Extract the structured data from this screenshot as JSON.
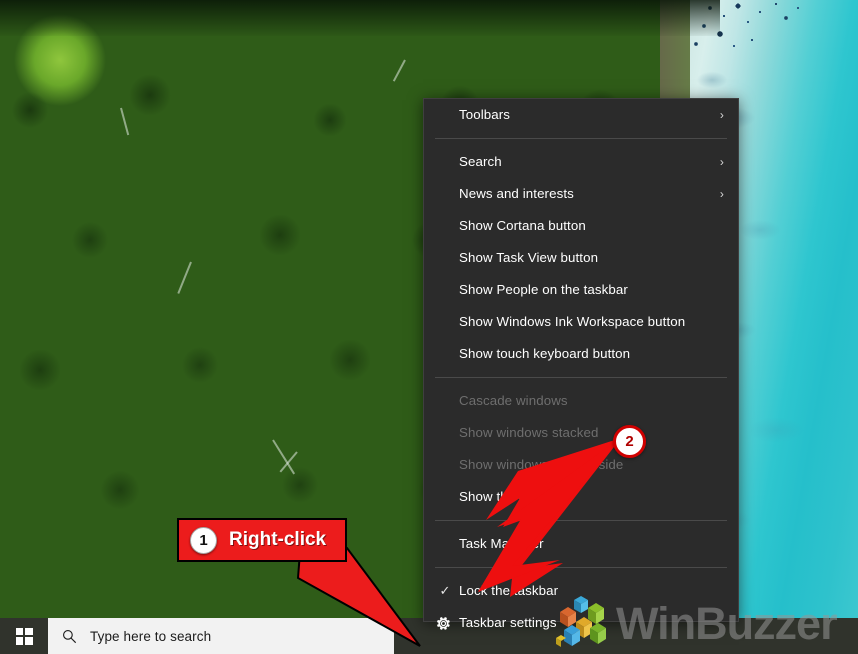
{
  "desktop": {
    "wallpaper_description": "aerial-forest-and-turquoise-sea",
    "colors": {
      "forest_green": "#6aa82a",
      "water_teal": "#2ec6cf",
      "sand": "#c9c2a5"
    }
  },
  "context_menu": {
    "name": "taskbar-context-menu",
    "background_color": "#2b2b2b",
    "text_color": "#ffffff",
    "items": [
      {
        "label": "Toolbars",
        "has_submenu": true,
        "disabled": false,
        "glyph": "",
        "separator_after": true
      },
      {
        "label": "Search",
        "has_submenu": true,
        "disabled": false,
        "glyph": "",
        "separator_after": false
      },
      {
        "label": "News and interests",
        "has_submenu": true,
        "disabled": false,
        "glyph": "",
        "separator_after": false
      },
      {
        "label": "Show Cortana button",
        "has_submenu": false,
        "disabled": false,
        "glyph": "",
        "separator_after": false
      },
      {
        "label": "Show Task View button",
        "has_submenu": false,
        "disabled": false,
        "glyph": "",
        "separator_after": false
      },
      {
        "label": "Show People on the taskbar",
        "has_submenu": false,
        "disabled": false,
        "glyph": "",
        "separator_after": false
      },
      {
        "label": "Show Windows Ink Workspace button",
        "has_submenu": false,
        "disabled": false,
        "glyph": "",
        "separator_after": false
      },
      {
        "label": "Show touch keyboard button",
        "has_submenu": false,
        "disabled": false,
        "glyph": "",
        "separator_after": true
      },
      {
        "label": "Cascade windows",
        "has_submenu": false,
        "disabled": true,
        "glyph": "",
        "separator_after": false
      },
      {
        "label": "Show windows stacked",
        "has_submenu": false,
        "disabled": true,
        "glyph": "",
        "separator_after": false
      },
      {
        "label": "Show windows side by side",
        "has_submenu": false,
        "disabled": true,
        "glyph": "",
        "separator_after": false
      },
      {
        "label": "Show the desktop",
        "has_submenu": false,
        "disabled": false,
        "glyph": "",
        "separator_after": true
      },
      {
        "label": "Task Manager",
        "has_submenu": false,
        "disabled": false,
        "glyph": "",
        "separator_after": true
      },
      {
        "label": "Lock the taskbar",
        "has_submenu": false,
        "disabled": false,
        "glyph": "checkmark-icon",
        "separator_after": false
      },
      {
        "label": "Taskbar settings",
        "has_submenu": false,
        "disabled": false,
        "glyph": "gear-icon",
        "separator_after": false
      }
    ],
    "submenu_arrow_glyph": "›"
  },
  "taskbar": {
    "start_button": {
      "name": "start-button",
      "icon": "windows-logo-icon"
    },
    "search": {
      "icon": "search-icon",
      "placeholder": "Type here to search",
      "background_color": "#f2f2f2"
    },
    "background_color": "#30332c"
  },
  "annotations": {
    "callout_1": {
      "step": "1",
      "label": "Right-click",
      "color": "#ec1c1c"
    },
    "badge_2": {
      "step": "2",
      "ring_color": "#d00000",
      "points_at": "Taskbar settings"
    }
  },
  "watermark": {
    "text": "WinBuzzer",
    "logo": "cube-logo-icon"
  }
}
